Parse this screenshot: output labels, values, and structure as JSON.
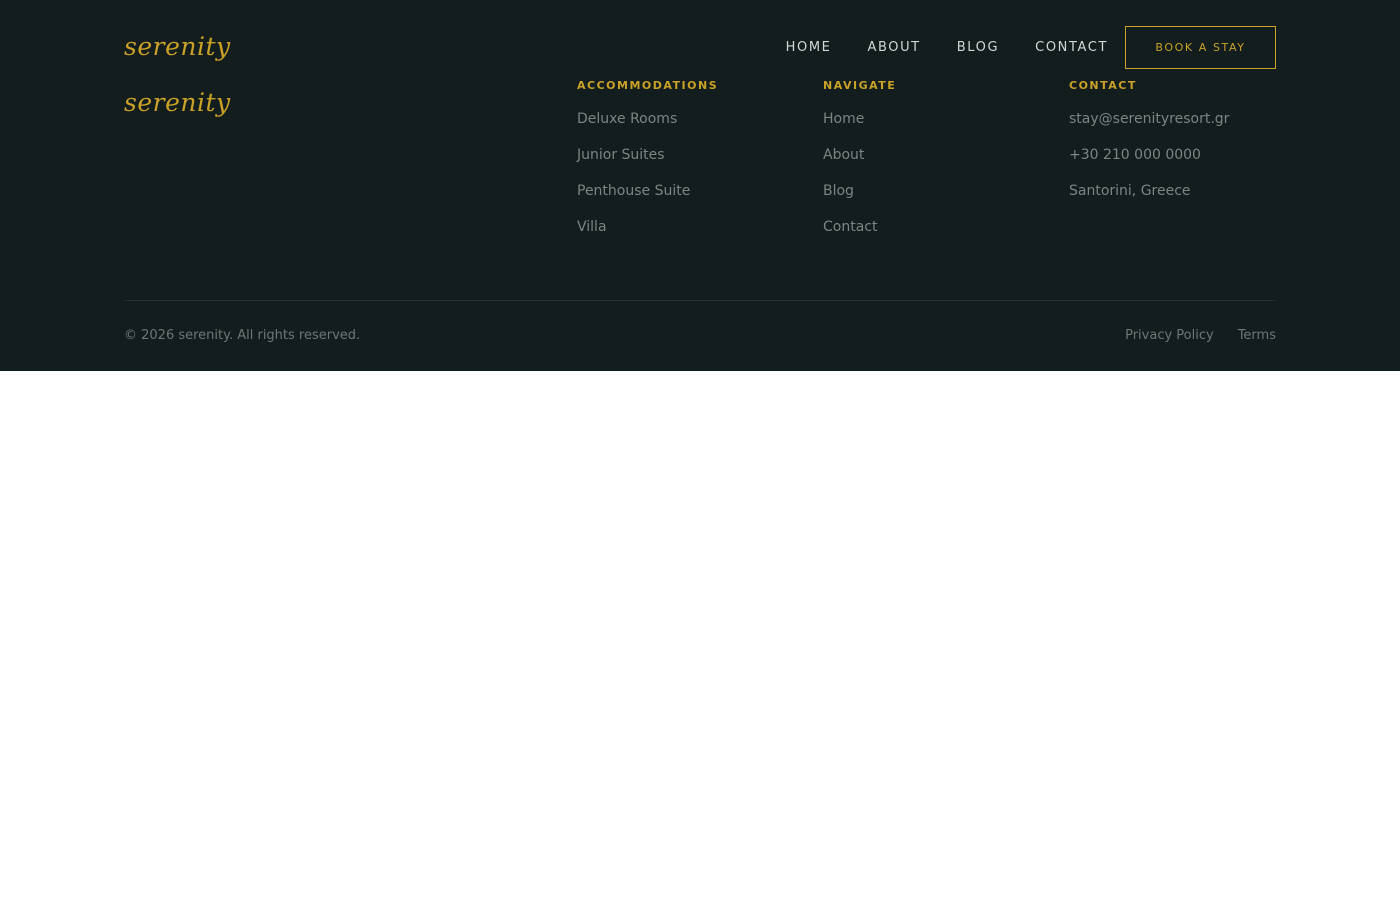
{
  "brand": {
    "logo_text": "serenity",
    "accent_color": "#c9a227",
    "background_color": "#131d1e"
  },
  "header": {
    "nav": [
      {
        "label": "HOME"
      },
      {
        "label": "ABOUT"
      },
      {
        "label": "BLOG"
      },
      {
        "label": "CONTACT"
      }
    ],
    "cta_label": "BOOK A STAY"
  },
  "footer": {
    "logo_text": "serenity",
    "columns": [
      {
        "title": "ACCOMMODATIONS",
        "items": [
          "Deluxe Rooms",
          "Junior Suites",
          "Penthouse Suite",
          "Villa"
        ]
      },
      {
        "title": "NAVIGATE",
        "items": [
          "Home",
          "About",
          "Blog",
          "Contact"
        ]
      },
      {
        "title": "CONTACT",
        "items": [
          "stay@serenityresort.gr",
          "+30 210 000 0000",
          "Santorini, Greece"
        ]
      }
    ],
    "copyright": "© 2026 serenity. All rights reserved.",
    "legal": [
      {
        "label": "Privacy Policy"
      },
      {
        "label": "Terms"
      }
    ]
  }
}
